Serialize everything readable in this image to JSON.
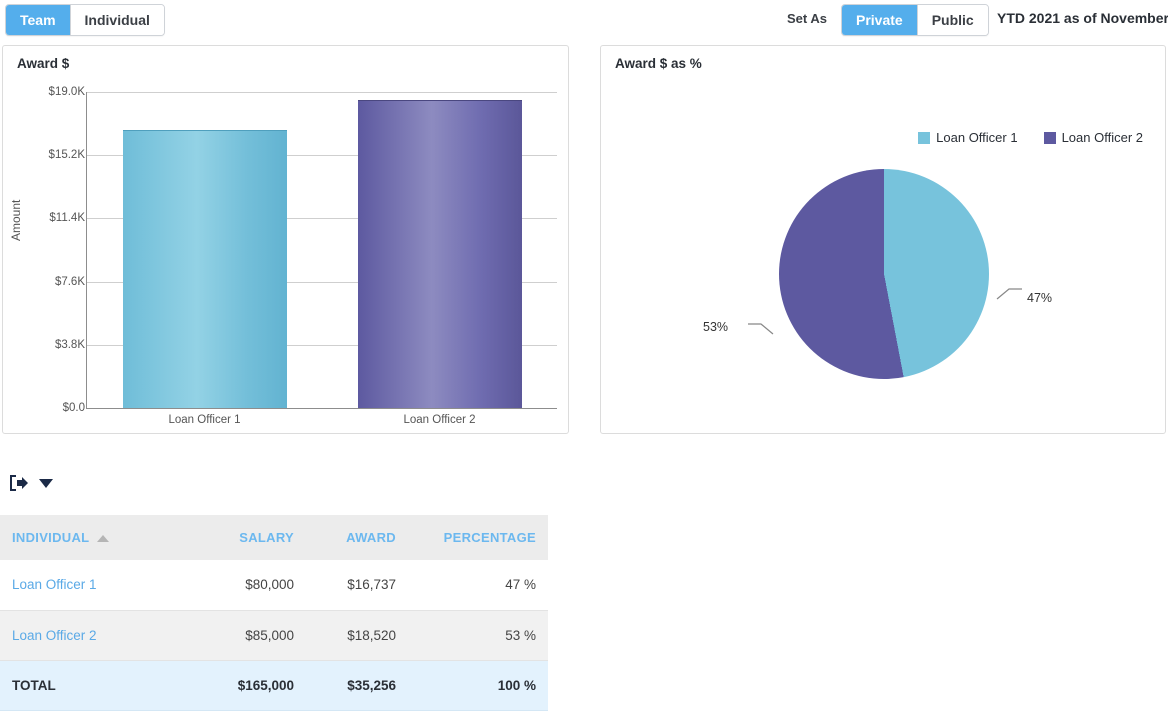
{
  "topbar": {
    "view_tabs": [
      {
        "label": "Team",
        "active": true
      },
      {
        "label": "Individual",
        "active": false
      }
    ],
    "set_as_label": "Set As",
    "visibility_tabs": [
      {
        "label": "Private",
        "active": true
      },
      {
        "label": "Public",
        "active": false
      }
    ],
    "period": "YTD 2021 as of November"
  },
  "bar_panel": {
    "title": "Award $"
  },
  "pie_panel": {
    "title": "Award $ as %",
    "legend": [
      {
        "label": "Loan Officer 1",
        "color": "#77c3dc"
      },
      {
        "label": "Loan Officer 2",
        "color": "#5d59a0"
      }
    ]
  },
  "toolbar": {
    "export_icon": "export-icon",
    "dropdown_icon": "caret-down-icon"
  },
  "table": {
    "columns": [
      {
        "key": "individual",
        "label": "INDIVIDUAL",
        "sorted": "asc"
      },
      {
        "key": "salary",
        "label": "SALARY"
      },
      {
        "key": "award",
        "label": "AWARD"
      },
      {
        "key": "percentage",
        "label": "PERCENTAGE"
      }
    ],
    "rows": [
      {
        "individual": "Loan Officer 1",
        "salary": "$80,000",
        "award": "$16,737",
        "percentage": "47 %"
      },
      {
        "individual": "Loan Officer 2",
        "salary": "$85,000",
        "award": "$18,520",
        "percentage": "53 %"
      }
    ],
    "total": {
      "individual": "TOTAL",
      "salary": "$165,000",
      "award": "$35,256",
      "percentage": "100 %"
    }
  },
  "chart_data": [
    {
      "type": "bar",
      "title": "Award $",
      "xlabel": "",
      "ylabel": "Amount",
      "categories": [
        "Loan Officer 1",
        "Loan Officer 2"
      ],
      "values": [
        16737,
        18520
      ],
      "ylim": [
        0,
        19000
      ],
      "yticks": [
        0,
        3800,
        7600,
        11400,
        15200,
        19000
      ],
      "ytick_labels": [
        "$0.0",
        "$3.8K",
        "$7.6K",
        "$11.4K",
        "$15.2K",
        "$19.0K"
      ],
      "grid": true,
      "legend": "none",
      "colors": [
        "#77c3dc",
        "#5d59a0"
      ]
    },
    {
      "type": "pie",
      "title": "Award $ as %",
      "labels": [
        "Loan Officer 1",
        "Loan Officer 2"
      ],
      "values": [
        47,
        53
      ],
      "data_labels": [
        "47%",
        "53%"
      ],
      "colors": [
        "#77c3dc",
        "#5d59a0"
      ],
      "legend": "top-right"
    }
  ]
}
